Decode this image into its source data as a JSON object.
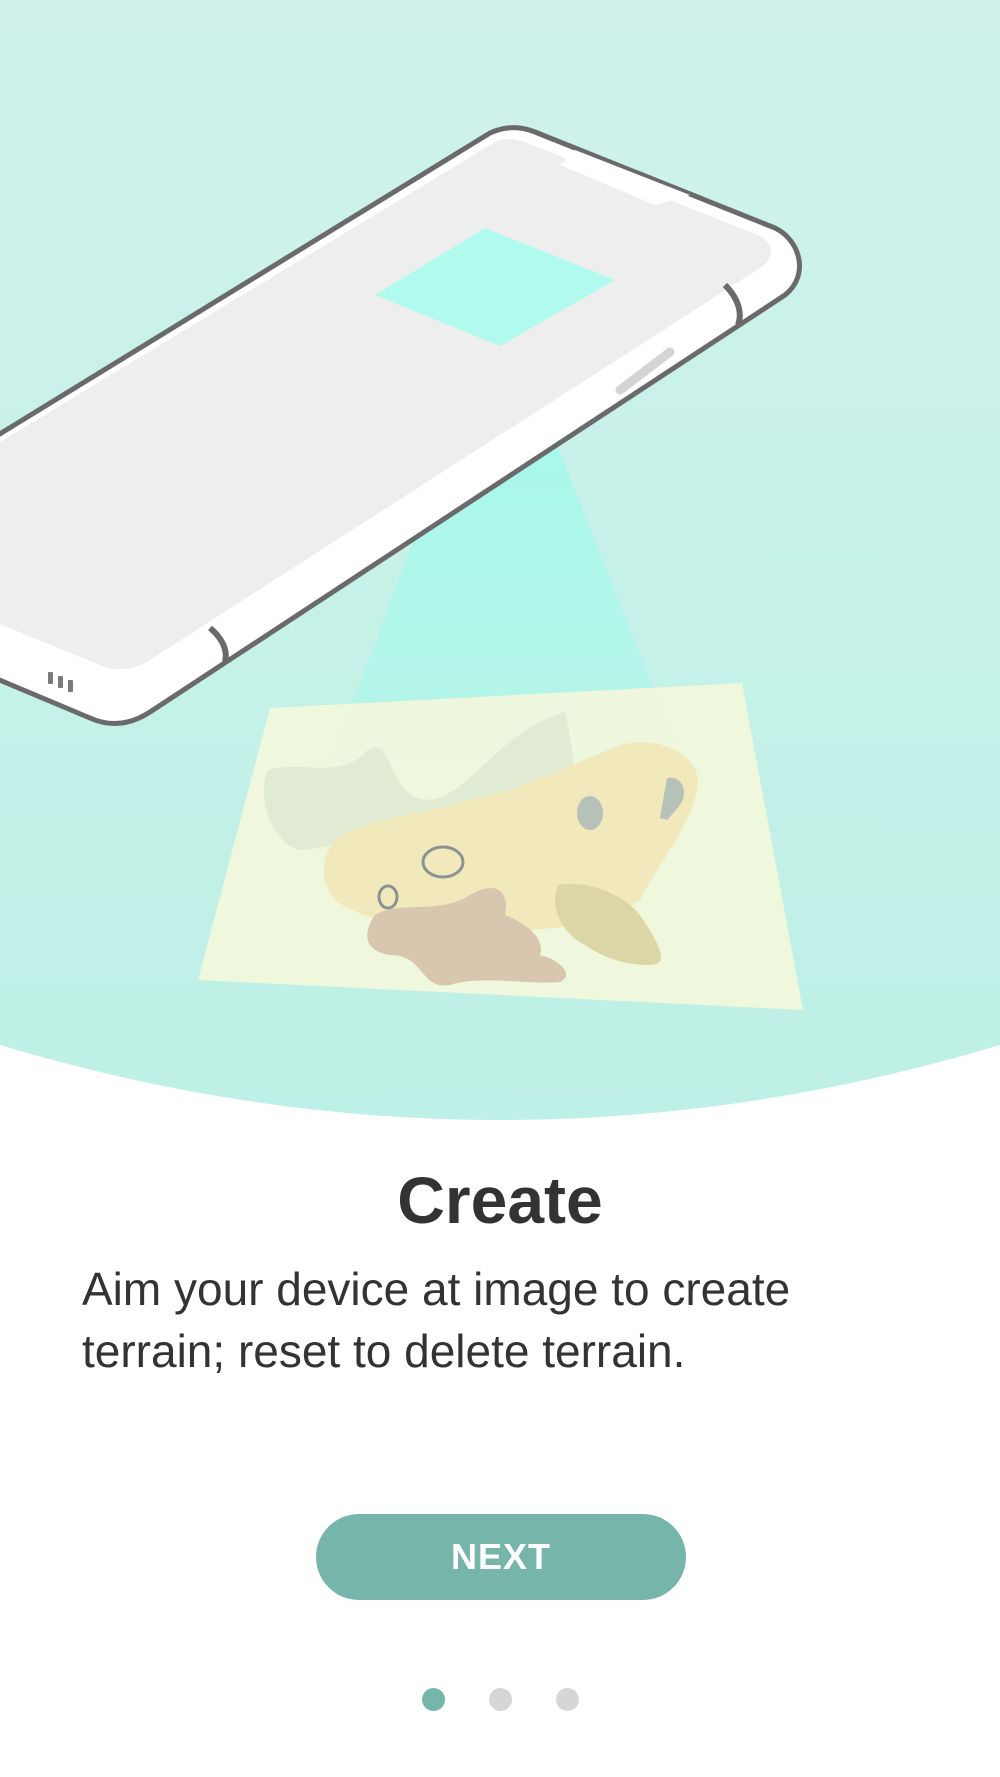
{
  "onboarding": {
    "title": "Create",
    "description": "Aim your device at image to create terrain; reset to delete terrain.",
    "next_label": "NEXT",
    "current_page": 1,
    "total_pages": 3
  },
  "colors": {
    "accent": "#76b5aa",
    "dot_inactive": "#d6d6d6",
    "hero_background": "#c4f1e8",
    "scan_beam": "#aef7ea"
  }
}
